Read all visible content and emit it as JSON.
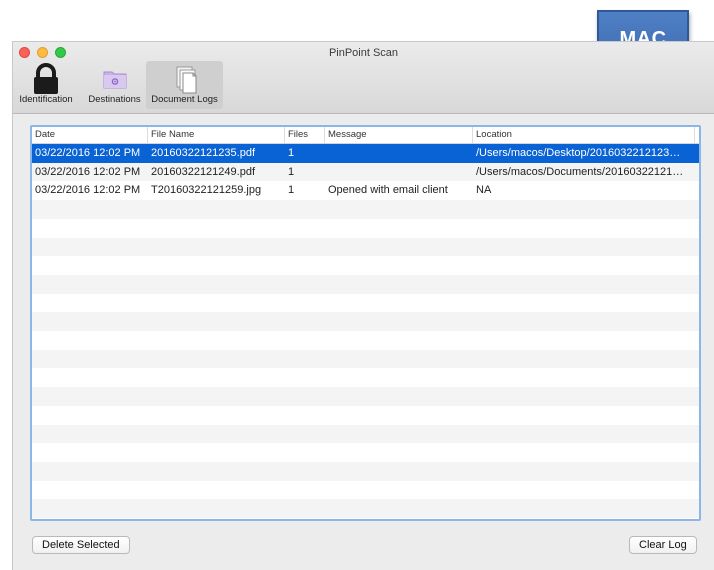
{
  "window": {
    "title": "PinPoint Scan"
  },
  "badge": {
    "label": "MAC"
  },
  "toolbar": {
    "items": [
      {
        "label": "Identification",
        "icon": "lock-icon"
      },
      {
        "label": "Destinations",
        "icon": "folder-icon"
      },
      {
        "label": "Document Logs",
        "icon": "documents-icon",
        "selected": true
      }
    ]
  },
  "table": {
    "columns": [
      "Date",
      "File Name",
      "Files",
      "Message",
      "Location"
    ],
    "rows": [
      {
        "date": "03/22/2016 12:02 PM",
        "file_name": "20160322121235.pdf",
        "files": "1",
        "message": "",
        "location": "/Users/macos/Desktop/2016032212123…",
        "selected": true
      },
      {
        "date": "03/22/2016 12:02 PM",
        "file_name": "20160322121249.pdf",
        "files": "1",
        "message": "",
        "location": "/Users/macos/Documents/20160322121…"
      },
      {
        "date": "03/22/2016 12:02 PM",
        "file_name": "T20160322121259.jpg",
        "files": "1",
        "message": "Opened with email client",
        "location": "NA"
      }
    ]
  },
  "buttons": {
    "delete_selected": "Delete Selected",
    "clear_log": "Clear Log"
  },
  "colors": {
    "selection": "#0a63d4",
    "focus_ring": "#8cb6e7",
    "badge": "#4a78be",
    "close": "#fc605b",
    "minimize": "#fdbc40",
    "maximize": "#34c84a"
  }
}
